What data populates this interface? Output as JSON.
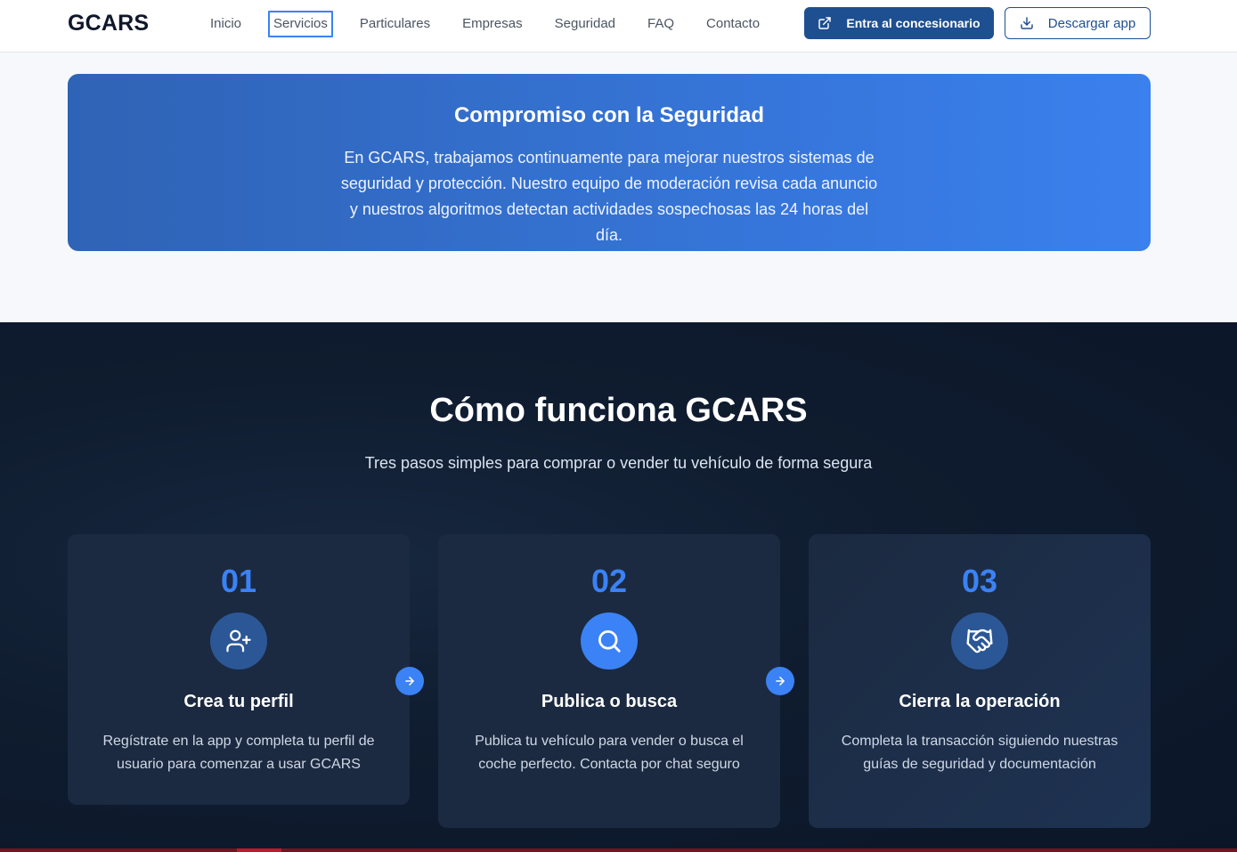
{
  "header": {
    "logo": "GCARS",
    "nav": [
      "Inicio",
      "Servicios",
      "Particulares",
      "Empresas",
      "Seguridad",
      "FAQ",
      "Contacto"
    ],
    "active_nav": "Servicios",
    "primary_button": {
      "label": "Entra al concesionario",
      "icon": "external-link-icon"
    },
    "secondary_button": {
      "label": "Descargar app",
      "icon": "download-icon"
    }
  },
  "security_banner": {
    "title": "Compromiso con la Seguridad",
    "text": "En GCARS, trabajamos continuamente para mejorar nuestros sistemas de seguridad y protección. Nuestro equipo de moderación revisa cada anuncio y nuestros algoritmos detectan actividades sospechosas las 24 horas del día."
  },
  "how_it_works": {
    "title": "Cómo funciona GCARS",
    "subtitle": "Tres pasos simples para comprar o vender tu vehículo de forma segura",
    "steps": [
      {
        "number": "01",
        "icon": "user-plus-icon",
        "title": "Crea tu perfil",
        "description": "Regístrate en la app y completa tu perfil de usuario para comenzar a usar GCARS"
      },
      {
        "number": "02",
        "icon": "search-icon",
        "title": "Publica o busca",
        "description": "Publica tu vehículo para vender o busca el coche perfecto. Contacta por chat seguro"
      },
      {
        "number": "03",
        "icon": "handshake-icon",
        "title": "Cierra la operación",
        "description": "Completa la transacción siguiendo nuestras guías de seguridad y documentación"
      }
    ],
    "step_arrow_icon": "arrow-right-icon"
  },
  "colors": {
    "brand_dark": "#1e4f91",
    "accent": "#3b82f6",
    "dark_bg": "#0f1c2f",
    "card_bg": "#1b2a40"
  }
}
